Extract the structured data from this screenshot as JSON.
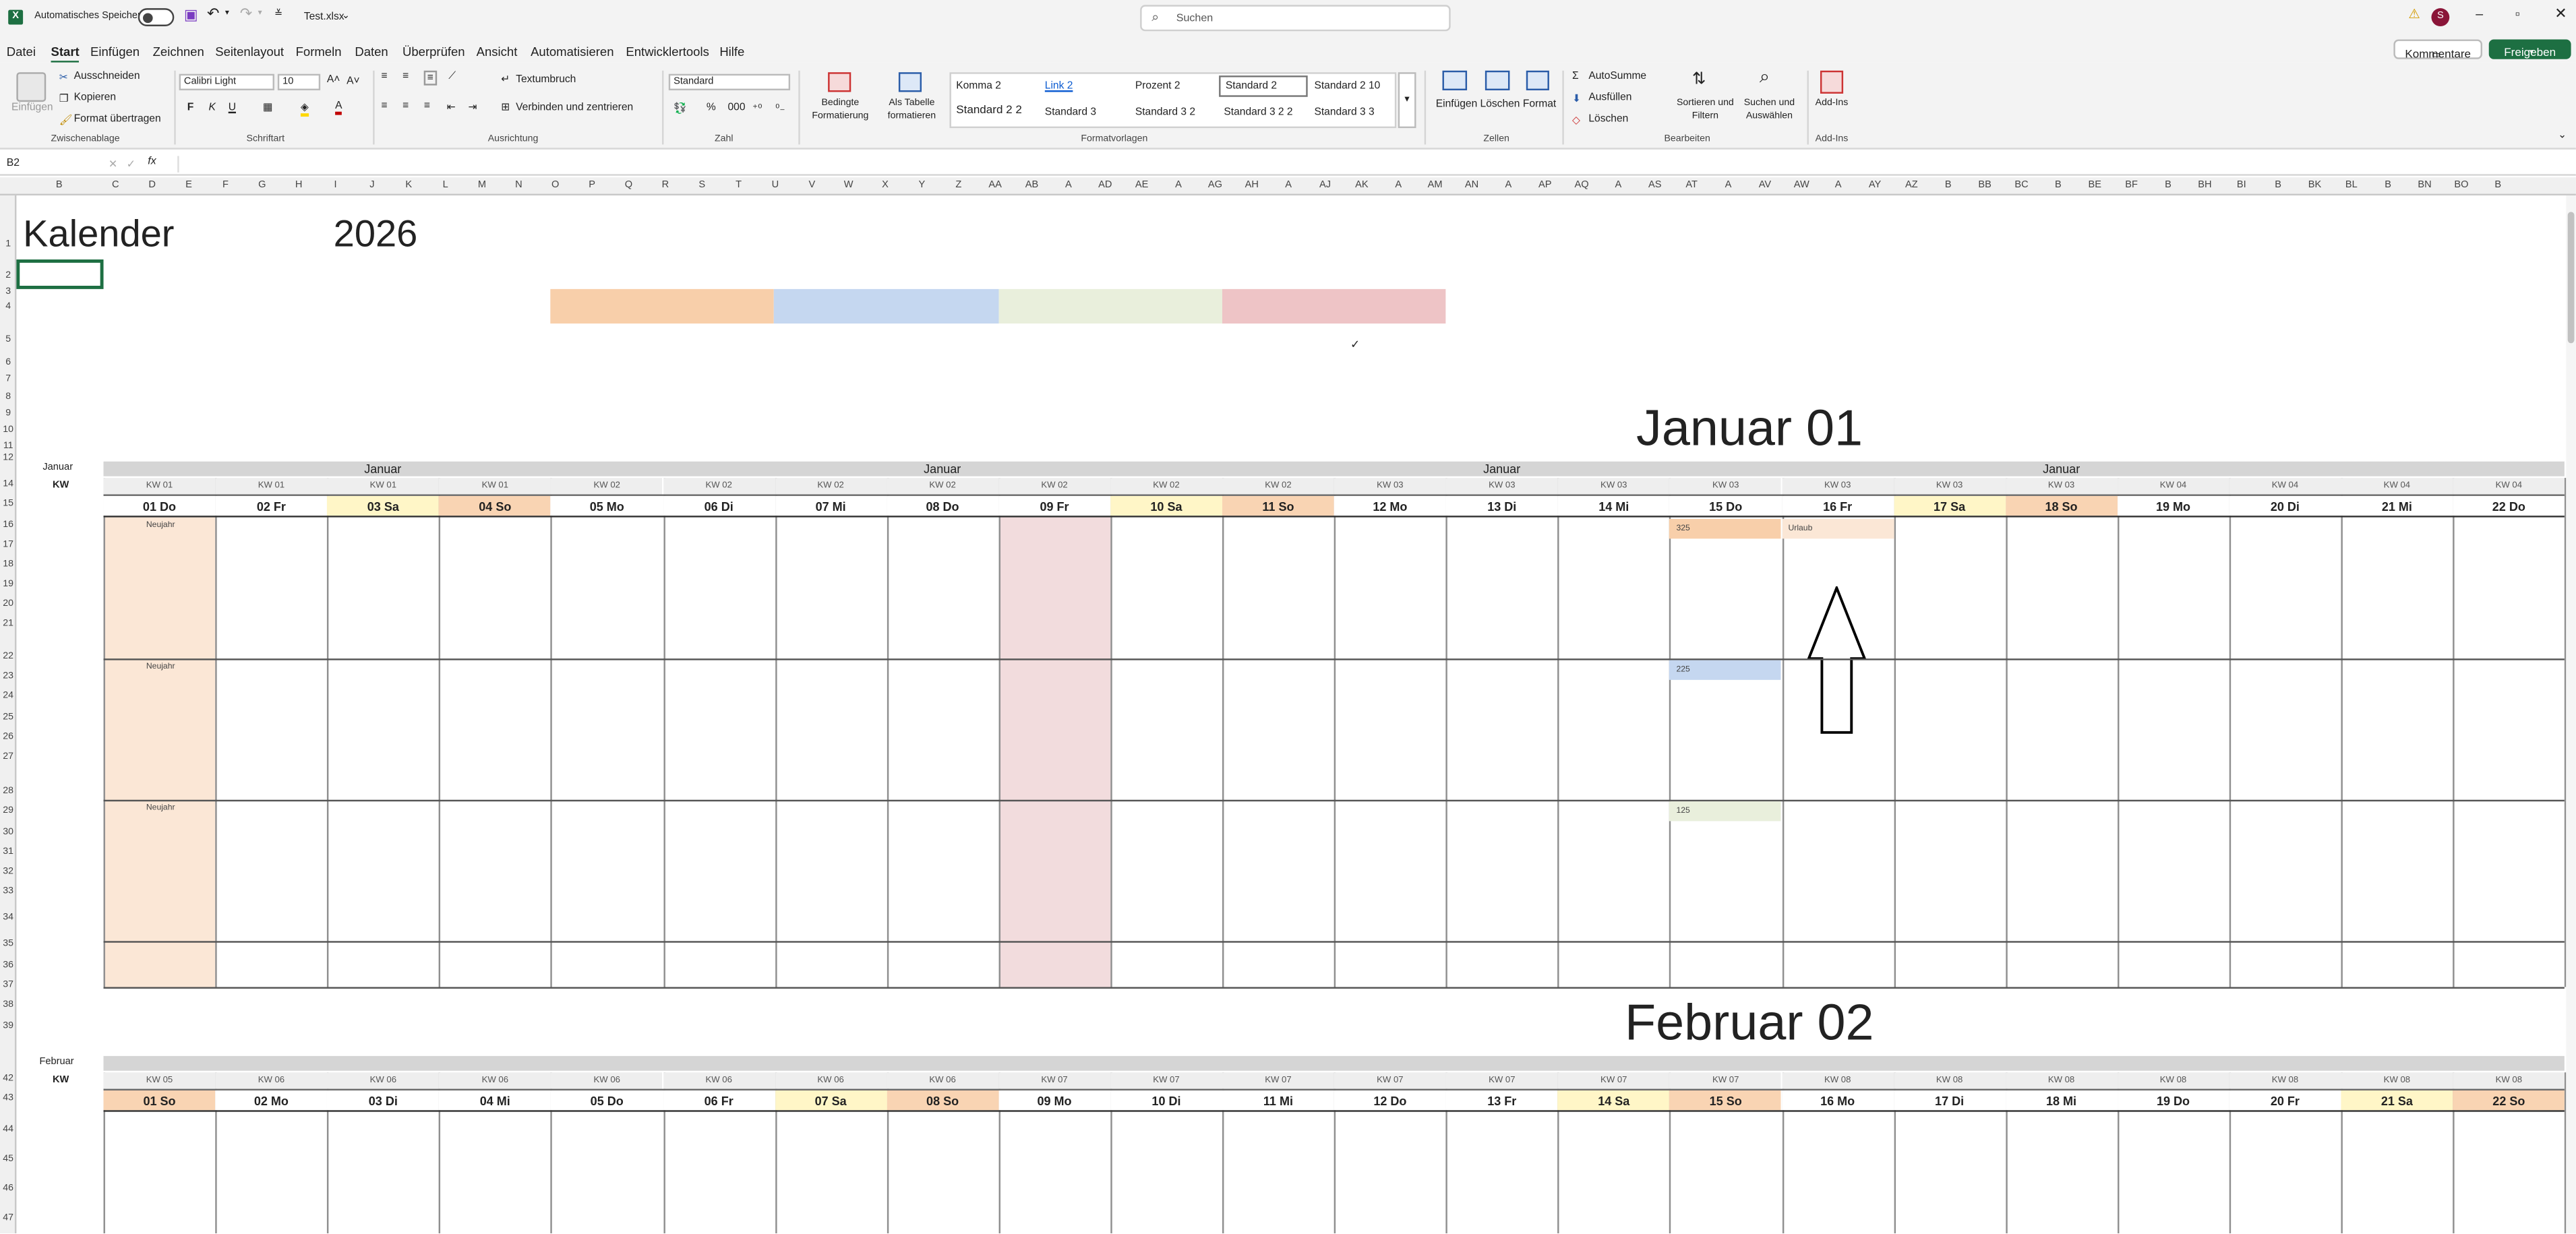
{
  "titlebar": {
    "autosave_label": "Automatisches Speichern",
    "filename": "Test.xlsx",
    "search_placeholder": "Suchen",
    "avatar_initial": "S"
  },
  "tabs": [
    "Datei",
    "Start",
    "Einfügen",
    "Zeichnen",
    "Seitenlayout",
    "Formeln",
    "Daten",
    "Überprüfen",
    "Ansicht",
    "Automatisieren",
    "Entwicklertools",
    "Hilfe"
  ],
  "actions": {
    "comments": "Kommentare",
    "share": "Freigeben"
  },
  "ribbon": {
    "clipboard": {
      "paste": "Einfügen",
      "cut": "Ausschneiden",
      "copy": "Kopieren",
      "format_painter": "Format übertragen",
      "group": "Zwischenablage"
    },
    "font": {
      "name": "Calibri Light",
      "size": "10",
      "bold": "F",
      "italic": "K",
      "underline": "U",
      "group": "Schriftart"
    },
    "alignment": {
      "wrap": "Textumbruch",
      "merge": "Verbinden und zentrieren",
      "group": "Ausrichtung"
    },
    "number": {
      "format": "Standard",
      "group": "Zahl"
    },
    "styles": {
      "conditional": "Bedingte Formatierung",
      "as_table": "Als Tabelle formatieren",
      "group": "Formatvorlagen",
      "items": [
        "Komma 2",
        "Link 2",
        "Prozent 2",
        "Standard 2",
        "Standard 2 10",
        "Standard 2 2",
        "Standard 3",
        "Standard 3 2",
        "Standard 3 2 2",
        "Standard 3 3"
      ]
    },
    "cells": {
      "insert": "Einfügen",
      "delete": "Löschen",
      "format": "Format",
      "group": "Zellen"
    },
    "editing": {
      "autosum": "AutoSumme",
      "fill": "Ausfüllen",
      "clear": "Löschen",
      "sort": "Sortieren und Filtern",
      "find": "Suchen und Auswählen",
      "group": "Bearbeiten"
    },
    "addins": {
      "label": "Add-Ins",
      "group": "Add-Ins"
    }
  },
  "formula_bar": {
    "name_box": "B2",
    "fx": "fx"
  },
  "columns": [
    "B",
    "C",
    "D",
    "E",
    "F",
    "G",
    "H",
    "I",
    "J",
    "K",
    "L",
    "M",
    "N",
    "O",
    "P",
    "Q",
    "R",
    "S",
    "T",
    "U",
    "V",
    "W",
    "X",
    "Y",
    "Z",
    "AA",
    "AB",
    "A",
    "AD",
    "AE",
    "A",
    "AG",
    "AH",
    "A",
    "AJ",
    "AK",
    "A",
    "AM",
    "AN",
    "A",
    "AP",
    "AQ",
    "A",
    "AS",
    "AT",
    "A",
    "AV",
    "AW",
    "A",
    "AY",
    "AZ",
    "B",
    "BB",
    "BC",
    "B",
    "BE",
    "BF",
    "B",
    "BH",
    "BI",
    "B",
    "BK",
    "BL",
    "B",
    "BN",
    "BO",
    "B"
  ],
  "rows": [
    "1",
    "2",
    "3",
    "4",
    "5",
    "6",
    "7",
    "8",
    "9",
    "10",
    "11",
    "12",
    "14",
    "15",
    "16",
    "17",
    "18",
    "19",
    "20",
    "21",
    "22",
    "23",
    "24",
    "25",
    "26",
    "27",
    "28",
    "29",
    "30",
    "31",
    "32",
    "33",
    "34",
    "35",
    "36",
    "37",
    "38",
    "39",
    "42",
    "43",
    "44",
    "45",
    "46",
    "47"
  ],
  "sheet": {
    "title": "Kalender",
    "year": "2026",
    "checkmark": "✓",
    "legend_colors": [
      "#f8cfaa",
      "#c5d7f0",
      "#e9efdc",
      "#eec4c6"
    ],
    "jan": {
      "big_title": "Januar 01",
      "side_month": "Januar",
      "side_kw": "KW",
      "band_label": "Januar",
      "kw": [
        "KW 01",
        "KW 01",
        "KW 01",
        "KW 01",
        "KW 02",
        "KW 02",
        "KW 02",
        "KW 02",
        "KW 02",
        "KW 02",
        "KW 02",
        "KW 03",
        "KW 03",
        "KW 03",
        "KW 03",
        "KW 03",
        "KW 03",
        "KW 03",
        "KW 04",
        "KW 04",
        "KW 04",
        "KW 04"
      ],
      "days": [
        "01 Do",
        "02 Fr",
        "03 Sa",
        "04 So",
        "05 Mo",
        "06 Di",
        "07 Mi",
        "08 Do",
        "09 Fr",
        "10 Sa",
        "11 So",
        "12 Mo",
        "13 Di",
        "14 Mi",
        "15 Do",
        "16 Fr",
        "17 Sa",
        "18 So",
        "19 Mo",
        "20 Di",
        "21 Mi",
        "22 Do"
      ],
      "notes": {
        "neujahr": "Neujahr",
        "urlaub": "Urlaub",
        "n325": "325",
        "n225": "225",
        "n125": "125"
      }
    },
    "feb": {
      "big_title": "Februar 02",
      "side_month": "Februar",
      "side_kw": "KW",
      "kw": [
        "KW 05",
        "KW 06",
        "KW 06",
        "KW 06",
        "KW 06",
        "KW 06",
        "KW 06",
        "KW 06",
        "KW 07",
        "KW 07",
        "KW 07",
        "KW 07",
        "KW 07",
        "KW 07",
        "KW 07",
        "KW 08",
        "KW 08",
        "KW 08",
        "KW 08",
        "KW 08",
        "KW 08",
        "KW 08"
      ],
      "days": [
        "01 So",
        "02 Mo",
        "03 Di",
        "04 Mi",
        "05 Do",
        "06 Fr",
        "07 Sa",
        "08 So",
        "09 Mo",
        "10 Di",
        "11 Mi",
        "12 Do",
        "13 Fr",
        "14 Sa",
        "15 So",
        "16 Mo",
        "17 Di",
        "18 Mi",
        "19 Do",
        "20 Fr",
        "21 Sa",
        "22 So"
      ]
    }
  }
}
